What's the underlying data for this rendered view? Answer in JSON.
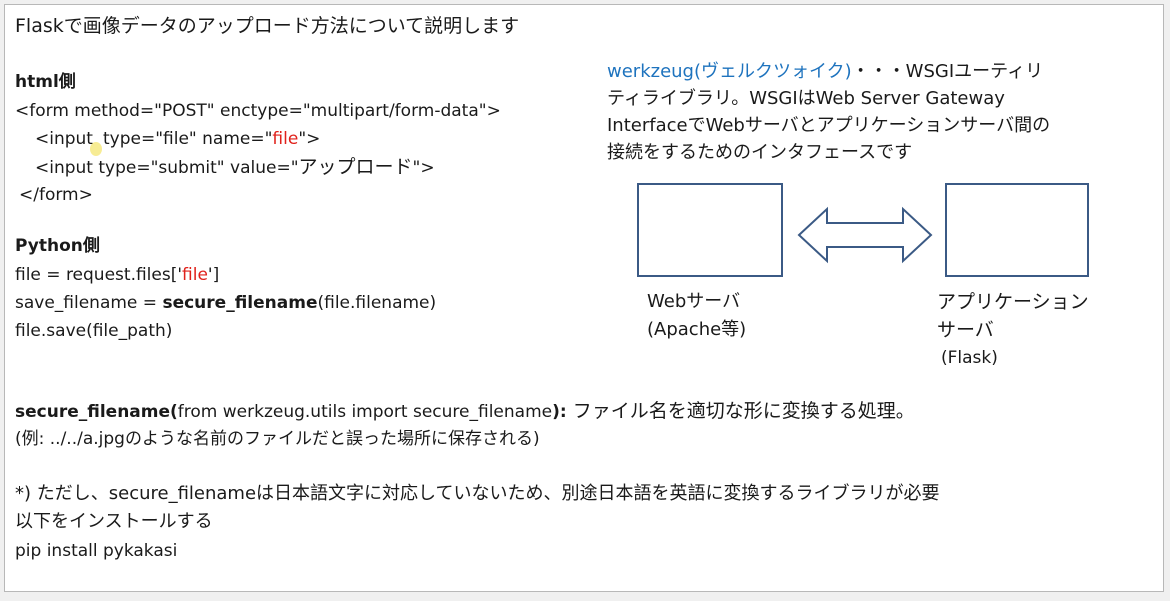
{
  "title": "Flaskで画像データのアップロード方法について説明します",
  "html_section": {
    "heading": "html側",
    "line1": "<form method=\"POST\" enctype=\"multipart/form-data\">",
    "line2_pre": "<input",
    "line2_mid": "type=\"file\" name=\"",
    "line2_val": "file",
    "line2_post": "\">",
    "line3_pre": "<input type=\"submit\" value=\"",
    "line3_val": "アップロード",
    "line3_post": "\">",
    "line4": "</form>"
  },
  "python_section": {
    "heading": "Python側",
    "line1_pre": "file = request.files['",
    "line1_val": "file",
    "line1_post": "']",
    "line2_pre": "save_filename = ",
    "line2_fn": "secure_filename",
    "line2_post": "(file.filename)",
    "line3": "file.save(file_path)"
  },
  "werkzeug": {
    "name": "werkzeug(ヴェルクツォイク)",
    "line1_rest": "・・・WSGIユーティリ",
    "line2": "ティライブラリ。WSGIはWeb Server Gateway",
    "line3": "InterfaceでWebサーバとアプリケーションサーバ間の",
    "line4": "接続をするためのインタフェースです"
  },
  "diagram": {
    "left_label1": "Webサーバ",
    "left_label2": "(Apache等)",
    "right_label1": "アプリケーション",
    "right_label2": "サーバ",
    "right_label3": "(Flask)"
  },
  "secure": {
    "line1_fn": "secure_filename(",
    "line1_mid": "from werkzeug.utils import secure_filename",
    "line1_close": "):",
    "line1_rest": " ファイル名を適切な形に変換する処理。",
    "line2": "(例: ../../a.jpgのような名前のファイルだと誤った場所に保存される)"
  },
  "note": {
    "line1": "*) ただし、secure_filenameは日本語文字に対応していないため、別途日本語を英語に変換するライブラリが必要",
    "line2": "以下をインストールする",
    "line3": "pip install pykakasi"
  }
}
